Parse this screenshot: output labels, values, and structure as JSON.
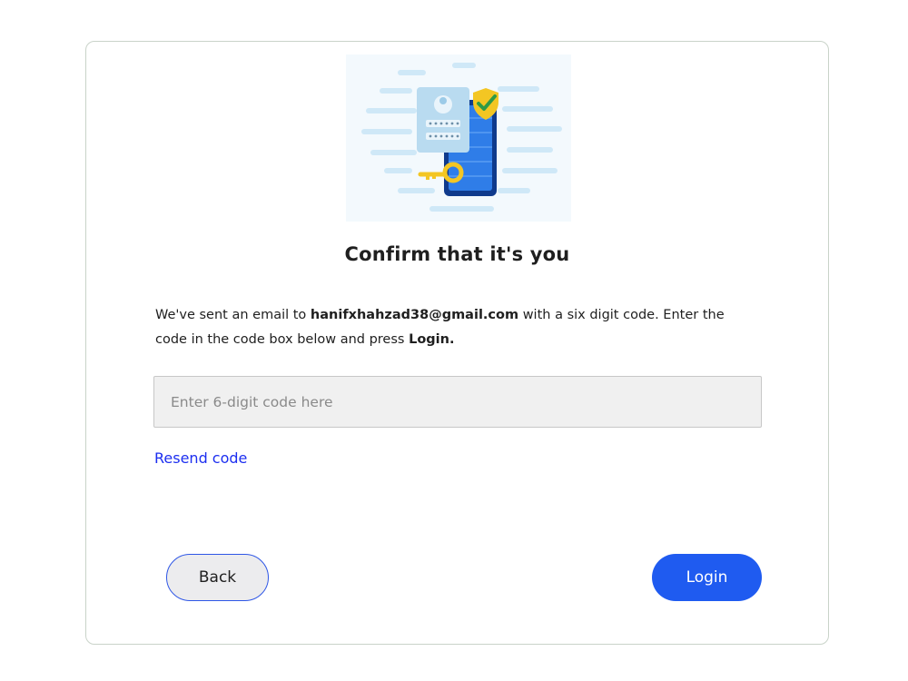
{
  "illustration": {
    "icon": "phone-id-card-key-verified-illustration"
  },
  "title": "Confirm that it's you",
  "instructions": {
    "part1": "We've sent an email to ",
    "email": "hanifxhahzad38@gmail.com",
    "part2": " with a six digit code. Enter the code in the code box below and press ",
    "login_word": "Login."
  },
  "code_input": {
    "value": "",
    "placeholder": "Enter 6-digit code here"
  },
  "resend_label": "Resend code",
  "buttons": {
    "back_label": "Back",
    "login_label": "Login"
  },
  "colors": {
    "primary": "#1f5bf0",
    "link": "#1c2ef0",
    "check_shield": "#f3c623",
    "key": "#f3c623"
  }
}
